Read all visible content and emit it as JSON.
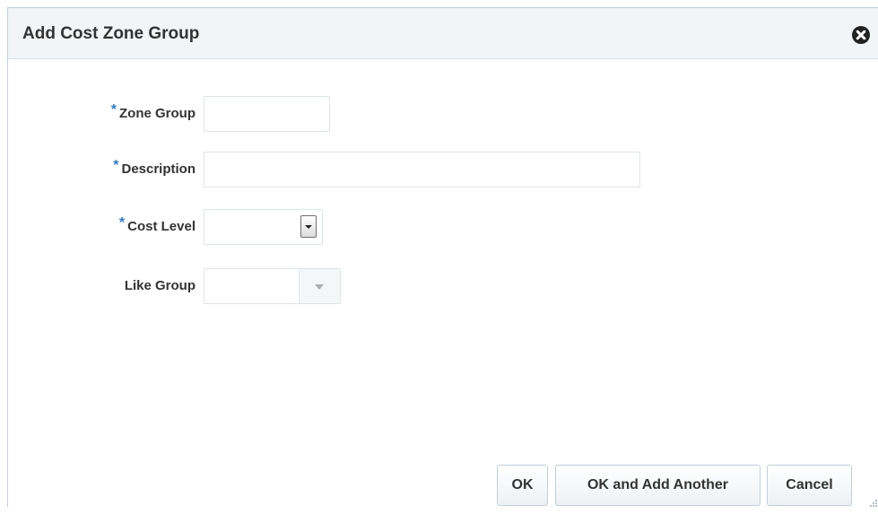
{
  "dialog": {
    "title": "Add Cost Zone Group",
    "close_icon": "close-circle-icon"
  },
  "form": {
    "zone_group": {
      "label": "Zone Group",
      "required": true,
      "value": ""
    },
    "description": {
      "label": "Description",
      "required": true,
      "value": ""
    },
    "cost_level": {
      "label": "Cost Level",
      "required": true,
      "selected": "",
      "dropdown_icon": "chevron-down-icon"
    },
    "like_group": {
      "label": "Like Group",
      "required": false,
      "selected": "",
      "disabled": true,
      "dropdown_icon": "chevron-down-icon"
    },
    "required_marker": "*"
  },
  "buttons": {
    "ok": "OK",
    "ok_and_add_another": "OK and Add Another",
    "cancel": "Cancel"
  },
  "colors": {
    "required_marker": "#2e7dc7",
    "header_bg": "#f2f4f5",
    "text": "#333333"
  }
}
